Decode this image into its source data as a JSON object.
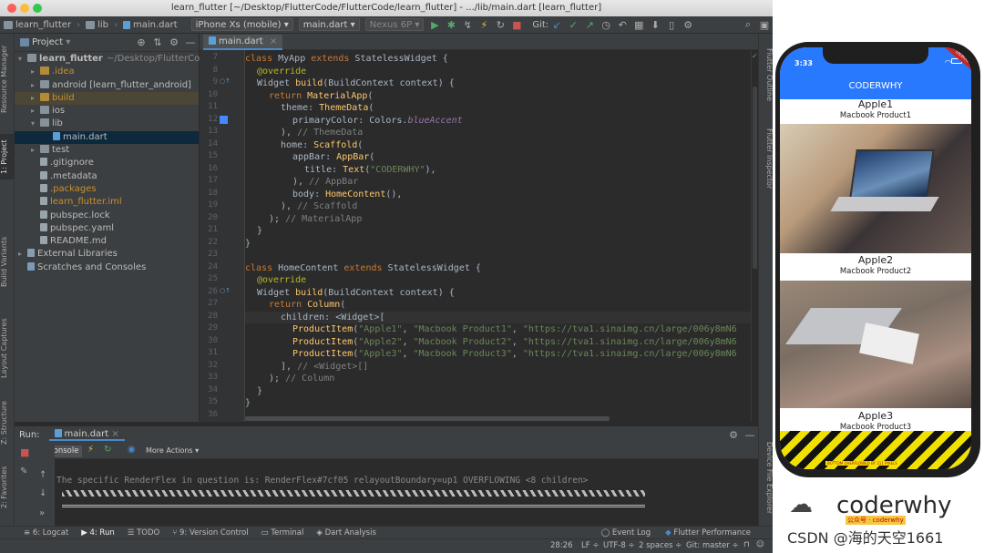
{
  "window": {
    "title": "learn_flutter [~/Desktop/FlutterCode/FlutterCode/learn_flutter] - .../lib/main.dart [learn_flutter]"
  },
  "navbar": {
    "crumbs": [
      "learn_flutter",
      "lib",
      "main.dart"
    ],
    "device": "iPhone Xs (mobile)",
    "run_config": "main.dart",
    "emulator": "Nexus 6P",
    "git_label": "Git:"
  },
  "left_stripe": {
    "tabs": [
      "Resource Manager",
      "1: Project",
      "Build Variants",
      "Layout Captures",
      "Z: Structure",
      "2: Favorites"
    ]
  },
  "project": {
    "title": "Project",
    "tree": [
      {
        "label": "learn_flutter",
        "suffix": "~/Desktop/FlutterCode/",
        "indent": 0,
        "kind": "folder",
        "open": true
      },
      {
        "label": ".idea",
        "indent": 1,
        "kind": "folder-orange",
        "open": false,
        "color": "#c98e2e"
      },
      {
        "label": "android [learn_flutter_android]",
        "indent": 1,
        "kind": "folder",
        "open": false
      },
      {
        "label": "build",
        "indent": 1,
        "kind": "folder-orange",
        "open": false,
        "color": "#c98e2e",
        "hl": true
      },
      {
        "label": "ios",
        "indent": 1,
        "kind": "folder",
        "open": false
      },
      {
        "label": "lib",
        "indent": 1,
        "kind": "folder",
        "open": true
      },
      {
        "label": "main.dart",
        "indent": 2,
        "kind": "dart",
        "sel": true
      },
      {
        "label": "test",
        "indent": 1,
        "kind": "folder",
        "open": false
      },
      {
        "label": ".gitignore",
        "indent": 1,
        "kind": "file"
      },
      {
        "label": ".metadata",
        "indent": 1,
        "kind": "file"
      },
      {
        "label": ".packages",
        "indent": 1,
        "kind": "file",
        "color": "#c98e2e"
      },
      {
        "label": "learn_flutter.iml",
        "indent": 1,
        "kind": "file",
        "color": "#c98e2e"
      },
      {
        "label": "pubspec.lock",
        "indent": 1,
        "kind": "file"
      },
      {
        "label": "pubspec.yaml",
        "indent": 1,
        "kind": "file"
      },
      {
        "label": "README.md",
        "indent": 1,
        "kind": "file"
      },
      {
        "label": "External Libraries",
        "indent": 0,
        "kind": "lib",
        "open": false
      },
      {
        "label": "Scratches and Consoles",
        "indent": 0,
        "kind": "scratch"
      }
    ]
  },
  "editor": {
    "tab": "main.dart",
    "lines": [
      {
        "n": "7",
        "html": [
          [
            "kw",
            "class "
          ],
          [
            "",
            "MyApp "
          ],
          [
            "kw",
            "extends "
          ],
          [
            "",
            "StatelessWidget {"
          ]
        ],
        "indent": 0
      },
      {
        "n": "8",
        "html": [
          [
            "an",
            "@override"
          ]
        ],
        "indent": 1
      },
      {
        "n": "9",
        "html": [
          [
            "",
            "Widget "
          ],
          [
            "cls",
            "build"
          ],
          [
            "",
            "(BuildContext context) {"
          ]
        ],
        "indent": 1
      },
      {
        "n": "10",
        "html": [
          [
            "kw",
            "return "
          ],
          [
            "cls",
            "MaterialApp"
          ],
          [
            "",
            "("
          ]
        ],
        "indent": 2
      },
      {
        "n": "11",
        "html": [
          [
            "",
            "theme: "
          ],
          [
            "cls",
            "ThemeData"
          ],
          [
            "",
            "("
          ]
        ],
        "indent": 3
      },
      {
        "n": "12",
        "html": [
          [
            "",
            "primaryColor: Colors."
          ],
          [
            "it",
            "blueAccent"
          ]
        ],
        "indent": 4
      },
      {
        "n": "13",
        "html": [
          [
            "",
            "), "
          ],
          [
            "cm",
            "// ThemeData"
          ]
        ],
        "indent": 3
      },
      {
        "n": "14",
        "html": [
          [
            "",
            "home: "
          ],
          [
            "cls",
            "Scaffold"
          ],
          [
            "",
            "("
          ]
        ],
        "indent": 3
      },
      {
        "n": "15",
        "html": [
          [
            "",
            "appBar: "
          ],
          [
            "cls",
            "AppBar"
          ],
          [
            "",
            "("
          ]
        ],
        "indent": 4
      },
      {
        "n": "16",
        "html": [
          [
            "",
            "title: "
          ],
          [
            "cls",
            "Text"
          ],
          [
            "",
            "("
          ],
          [
            "str",
            "\"CODERWHY\""
          ],
          [
            "",
            "),"
          ]
        ],
        "indent": 5
      },
      {
        "n": "17",
        "html": [
          [
            "",
            "), "
          ],
          [
            "cm",
            "// AppBar"
          ]
        ],
        "indent": 4
      },
      {
        "n": "18",
        "html": [
          [
            "",
            "body: "
          ],
          [
            "cls",
            "HomeContent"
          ],
          [
            "",
            "(),"
          ]
        ],
        "indent": 4
      },
      {
        "n": "19",
        "html": [
          [
            "",
            "), "
          ],
          [
            "cm",
            "// Scaffold"
          ]
        ],
        "indent": 3
      },
      {
        "n": "20",
        "html": [
          [
            "",
            "); "
          ],
          [
            "cm",
            "// MaterialApp"
          ]
        ],
        "indent": 2
      },
      {
        "n": "21",
        "html": [
          [
            "",
            "}"
          ]
        ],
        "indent": 1
      },
      {
        "n": "22",
        "html": [
          [
            "",
            "}"
          ]
        ],
        "indent": 0
      },
      {
        "n": "23",
        "html": [],
        "indent": 0
      },
      {
        "n": "24",
        "html": [
          [
            "kw",
            "class "
          ],
          [
            "",
            "HomeContent "
          ],
          [
            "kw",
            "extends "
          ],
          [
            "",
            "StatelessWidget {"
          ]
        ],
        "indent": 0
      },
      {
        "n": "25",
        "html": [
          [
            "an",
            "@override"
          ]
        ],
        "indent": 1
      },
      {
        "n": "26",
        "html": [
          [
            "",
            "Widget "
          ],
          [
            "cls",
            "build"
          ],
          [
            "",
            "(BuildContext context) {"
          ]
        ],
        "indent": 1
      },
      {
        "n": "27",
        "html": [
          [
            "kw",
            "return "
          ],
          [
            "cls",
            "Column"
          ],
          [
            "",
            "("
          ]
        ],
        "indent": 2
      },
      {
        "n": "28",
        "html": [
          [
            "",
            "children: <Widget>["
          ]
        ],
        "indent": 3
      },
      {
        "n": "29",
        "html": [
          [
            "cls",
            "ProductItem"
          ],
          [
            "",
            "("
          ],
          [
            "str",
            "\"Apple1\""
          ],
          [
            "",
            ", "
          ],
          [
            "str",
            "\"Macbook Product1\""
          ],
          [
            "",
            ", "
          ],
          [
            "str",
            "\"https://tva1.sinaimg.cn/large/006y8mN6"
          ]
        ],
        "indent": 4
      },
      {
        "n": "30",
        "html": [
          [
            "cls",
            "ProductItem"
          ],
          [
            "",
            "("
          ],
          [
            "str",
            "\"Apple2\""
          ],
          [
            "",
            ", "
          ],
          [
            "str",
            "\"Macbook Product2\""
          ],
          [
            "",
            ", "
          ],
          [
            "str",
            "\"https://tva1.sinaimg.cn/large/006y8mN6"
          ]
        ],
        "indent": 4
      },
      {
        "n": "31",
        "html": [
          [
            "cls",
            "ProductItem"
          ],
          [
            "",
            "("
          ],
          [
            "str",
            "\"Apple3\""
          ],
          [
            "",
            ", "
          ],
          [
            "str",
            "\"Macbook Product3\""
          ],
          [
            "",
            ", "
          ],
          [
            "str",
            "\"https://tva1.sinaimg.cn/large/006y8mN6"
          ]
        ],
        "indent": 4
      },
      {
        "n": "32",
        "html": [
          [
            "",
            "], "
          ],
          [
            "cm",
            "// <Widget>[]"
          ]
        ],
        "indent": 3
      },
      {
        "n": "33",
        "html": [
          [
            "",
            "); "
          ],
          [
            "cm",
            "// Column"
          ]
        ],
        "indent": 2
      },
      {
        "n": "34",
        "html": [
          [
            "",
            "}"
          ]
        ],
        "indent": 1
      },
      {
        "n": "35",
        "html": [
          [
            "",
            "}"
          ]
        ],
        "indent": 0
      },
      {
        "n": "36",
        "html": [],
        "indent": 0
      }
    ]
  },
  "right_stripe": {
    "tabs": [
      "Flutter Outline",
      "Flutter Inspector",
      "Device File Explorer"
    ]
  },
  "run": {
    "label": "Run:",
    "config": "main.dart",
    "console_tab": "Console",
    "more_actions": "More Actions",
    "message": "The specific RenderFlex in question is: RenderFlex#7cf05 relayoutBoundary=up1 OVERFLOWING <8 children>"
  },
  "bottom_tabs": [
    "6: Logcat",
    "4: Run",
    "TODO",
    "9: Version Control",
    "Terminal",
    "Dart Analysis"
  ],
  "bottom_right_tabs": [
    "Event Log",
    "Flutter Performance"
  ],
  "status": {
    "position": "28:26",
    "line_sep": "LF",
    "encoding": "UTF-8",
    "indent": "2 spaces",
    "git": "Git: master"
  },
  "simulator": {
    "time": "3:33",
    "appbar_title": "CODERWHY",
    "products": [
      {
        "title": "Apple1",
        "desc": "Macbook Product1"
      },
      {
        "title": "Apple2",
        "desc": "Macbook Product2"
      },
      {
        "title": "Apple3",
        "desc": "Macbook Product3"
      }
    ],
    "overflow_text": "BOTTOM OVERFLOWED BY 211 PIXELS"
  },
  "watermark": {
    "brand": "coderwhy",
    "credit": "CSDN @海的天空1661",
    "badge": "公众号 · coderwhy"
  }
}
